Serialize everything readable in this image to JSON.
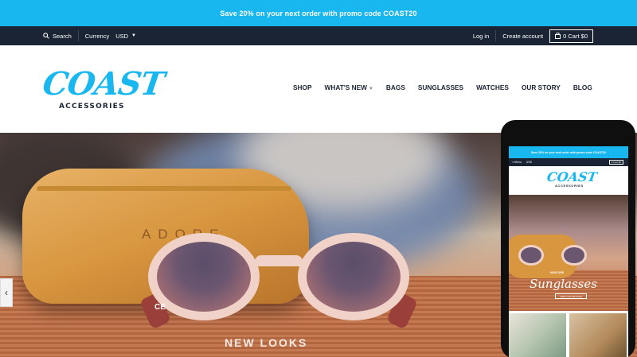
{
  "promo": {
    "text": "Save 20% on your next order with promo code COAST20"
  },
  "utility": {
    "search_label": "Search",
    "currency_label": "Currency",
    "currency_value": "USD",
    "login": "Log in",
    "create_account": "Create account",
    "cart_label": "0 Cart $0"
  },
  "logo": {
    "word": "COAST",
    "sub": "ACCESSORIES"
  },
  "nav": {
    "shop": "SHOP",
    "whats_new": "WHAT'S NEW",
    "bags": "BAGS",
    "sunglasses": "SUNGLASSES",
    "watches": "WATCHES",
    "our_story": "OUR STORY",
    "blog": "BLOG"
  },
  "hero": {
    "case_brand": "ADORE",
    "ce_mark": "CE",
    "caption": "NEW LOOKS",
    "prev_arrow": "‹"
  },
  "phone": {
    "promo": "Save 20% on your next order with promo code COAST20",
    "menu": "≡ Menu",
    "currency": "USD",
    "cart": "0 Cart $0",
    "logo": "COAST",
    "logo_sub": "ACCESSORIES",
    "hero_sub": "HOW ONE",
    "hero_title": "Sunglasses",
    "hero_button": "VIEW COLLECTION"
  },
  "colors": {
    "accent": "#18b7f0",
    "dark": "#1b2434"
  }
}
